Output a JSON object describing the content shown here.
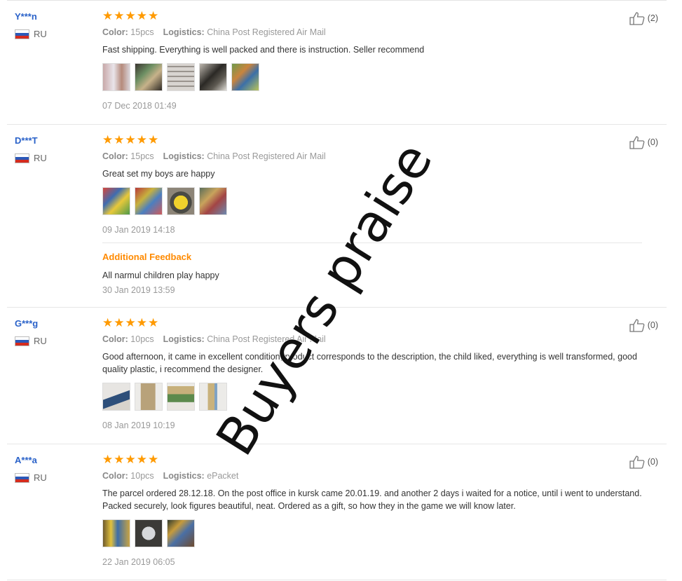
{
  "reviews": [
    {
      "user": "Y***n",
      "country": "RU",
      "rating": 5,
      "color_label": "Color:",
      "color_value": "15pcs",
      "logistics_label": "Logistics:",
      "logistics_value": "China Post Registered Air Mail",
      "text": "Fast shipping. Everything is well packed and there is instruction. Seller recommend",
      "photo_count": 5,
      "date": "07 Dec 2018 01:49",
      "helpful": "(2)"
    },
    {
      "user": "D***T",
      "country": "RU",
      "rating": 5,
      "color_label": "Color:",
      "color_value": "15pcs",
      "logistics_label": "Logistics:",
      "logistics_value": "China Post Registered Air Mail",
      "text": "Great set my boys are happy",
      "photo_count": 4,
      "date": "09 Jan 2019 14:18",
      "helpful": "(0)",
      "additional_title": "Additional Feedback",
      "additional_text": "All narmul children play happy",
      "additional_date": "30 Jan 2019 13:59"
    },
    {
      "user": "G***g",
      "country": "RU",
      "rating": 5,
      "color_label": "Color:",
      "color_value": "10pcs",
      "logistics_label": "Logistics:",
      "logistics_value": "China Post Registered Air Mail",
      "text": "Good afternoon, it came in excellent condition, product corresponds to the description, the child liked, everything is well transformed, good quality plastic, i recommend the designer.",
      "photo_count": 4,
      "date": "08 Jan 2019 10:19",
      "helpful": "(0)"
    },
    {
      "user": "A***a",
      "country": "RU",
      "rating": 5,
      "color_label": "Color:",
      "color_value": "10pcs",
      "logistics_label": "Logistics:",
      "logistics_value": "ePacket",
      "text": "The parcel ordered 28.12.18. On the post office in kursk came 20.01.19. and another 2 days i waited for a notice, until i went to understand. Packed securely, look figures beautiful, neat. Ordered as a gift, so how they in the game we will know later.",
      "photo_count": 3,
      "date": "22 Jan 2019 06:05",
      "helpful": "(0)"
    }
  ],
  "watermark": "Buyers praise",
  "colors": {
    "star": "#ff9a00",
    "username": "#2a62c9",
    "additional_title": "#ff8a00"
  }
}
